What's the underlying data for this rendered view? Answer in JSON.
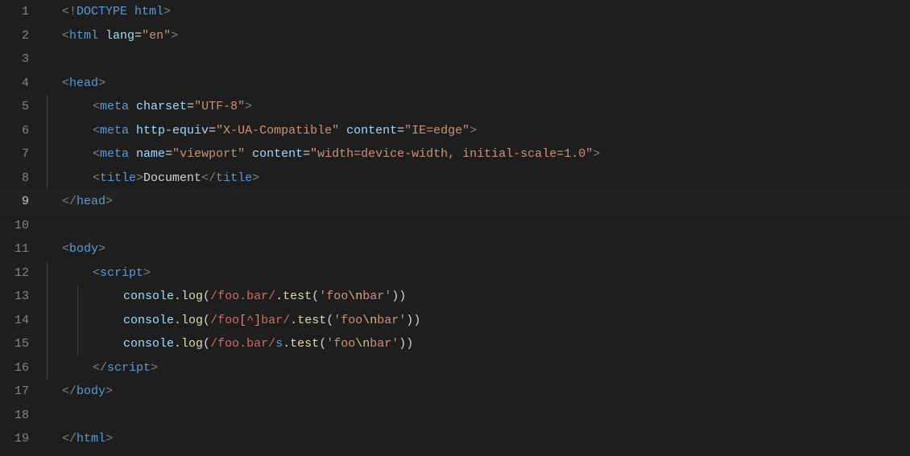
{
  "activeLine": 9,
  "lineNumbers": [
    "1",
    "2",
    "3",
    "4",
    "5",
    "6",
    "7",
    "8",
    "9",
    "10",
    "11",
    "12",
    "13",
    "14",
    "15",
    "16",
    "17",
    "18",
    "19"
  ],
  "tokens": {
    "l1_open": "<!",
    "l1_doctype": "DOCTYPE",
    "l1_html": " html",
    "l1_close": ">",
    "l2_open": "<",
    "l2_tag": "html",
    "l2_attr": "lang",
    "l2_eq": "=",
    "l2_val": "\"en\"",
    "l2_close": ">",
    "l4_open": "<",
    "l4_tag": "head",
    "l4_close": ">",
    "l5_open": "<",
    "l5_tag": "meta",
    "l5_attr": "charset",
    "l5_eq": "=",
    "l5_val": "\"UTF-8\"",
    "l5_close": ">",
    "l6_open": "<",
    "l6_tag": "meta",
    "l6_attr1": "http-equiv",
    "l6_eq": "=",
    "l6_val1": "\"X-UA-Compatible\"",
    "l6_attr2": "content",
    "l6_val2": "\"IE=edge\"",
    "l6_close": ">",
    "l7_open": "<",
    "l7_tag": "meta",
    "l7_attr1": "name",
    "l7_val1": "\"viewport\"",
    "l7_attr2": "content",
    "l7_val2": "\"width=device-width, initial-scale=1.0\"",
    "l7_close": ">",
    "l8_open": "<",
    "l8_tag": "title",
    "l8_close": ">",
    "l8_text": "Document",
    "l8_open2": "</",
    "l8_close2": ">",
    "l9_open": "</",
    "l9_tag": "head",
    "l9_close": ">",
    "l11_open": "<",
    "l11_tag": "body",
    "l11_close": ">",
    "l12_open": "<",
    "l12_tag": "script",
    "l12_close": ">",
    "l13_console": "console",
    "l13_dot": ".",
    "l13_log": "log",
    "l13_po": "(",
    "l13_rs": "/",
    "l13_r1": "foo",
    "l13_rdot": ".",
    "l13_r2": "bar",
    "l13_re": "/",
    "l13_dot2": ".",
    "l13_test": "test",
    "l13_po2": "(",
    "l13_sq": "'",
    "l13_s1": "foo",
    "l13_esc": "\\n",
    "l13_s2": "bar",
    "l13_pc": ")",
    "l14_rs": "/",
    "l14_r1": "foo",
    "l14_rb1": "[",
    "l14_caret": "^",
    "l14_rb2": "]",
    "l14_r2": "bar",
    "l14_re": "/",
    "l15_rs": "/",
    "l15_r1": "foo",
    "l15_rdot": ".",
    "l15_r2": "bar",
    "l15_re": "/",
    "l15_flag": "s",
    "l16_open": "</",
    "l16_tag": "script",
    "l16_close": ">",
    "l17_open": "</",
    "l17_tag": "body",
    "l17_close": ">",
    "l19_open": "</",
    "l19_tag": "html",
    "l19_close": ">"
  }
}
